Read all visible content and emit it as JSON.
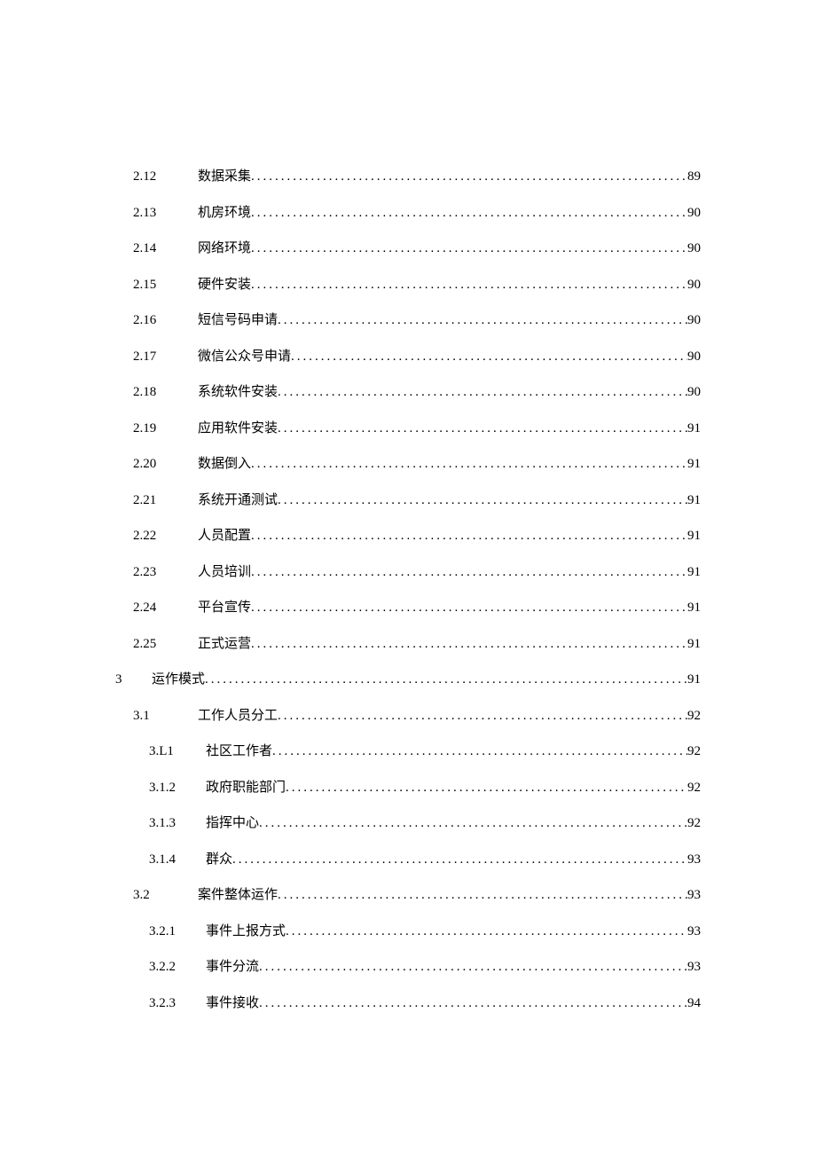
{
  "toc": [
    {
      "level": 1,
      "num": "2.12",
      "title": "数据采集",
      "page": "89"
    },
    {
      "level": 1,
      "num": "2.13",
      "title": "机房环境",
      "page": "90"
    },
    {
      "level": 1,
      "num": "2.14",
      "title": "网络环境",
      "page": "90"
    },
    {
      "level": 1,
      "num": "2.15",
      "title": "硬件安装",
      "page": "90"
    },
    {
      "level": 1,
      "num": "2.16",
      "title": "短信号码申请",
      "page": "90"
    },
    {
      "level": 1,
      "num": "2.17",
      "title": "微信公众号申请",
      "page": "90"
    },
    {
      "level": 1,
      "num": "2.18",
      "title": "系统软件安装",
      "page": "90"
    },
    {
      "level": 1,
      "num": "2.19",
      "title": "应用软件安装",
      "page": "91"
    },
    {
      "level": 1,
      "num": "2.20",
      "title": "数据倒入",
      "page": "91"
    },
    {
      "level": 1,
      "num": "2.21",
      "title": "系统开通测试",
      "page": "91"
    },
    {
      "level": 1,
      "num": "2.22",
      "title": "人员配置",
      "page": "91"
    },
    {
      "level": 1,
      "num": "2.23",
      "title": "人员培训",
      "page": "91"
    },
    {
      "level": 1,
      "num": "2.24",
      "title": "平台宣传",
      "page": "91"
    },
    {
      "level": 1,
      "num": "2.25",
      "title": "正式运营",
      "page": "91"
    },
    {
      "level": 0,
      "num": "3",
      "title": "运作模式",
      "page": "91"
    },
    {
      "level": 1,
      "num": "3.1",
      "title": "工作人员分工",
      "page": "92"
    },
    {
      "level": 2,
      "num": "3.L1",
      "title": "社区工作者",
      "page": "92"
    },
    {
      "level": 2,
      "num": "3.1.2",
      "title": "政府职能部门",
      "page": "92"
    },
    {
      "level": 2,
      "num": "3.1.3",
      "title": "指挥中心",
      "page": "92"
    },
    {
      "level": 2,
      "num": "3.1.4",
      "title": "群众",
      "page": "93"
    },
    {
      "level": 1,
      "num": "3.2",
      "title": "案件整体运作",
      "page": "93"
    },
    {
      "level": 2,
      "num": "3.2.1",
      "title": "事件上报方式",
      "page": "93"
    },
    {
      "level": 2,
      "num": "3.2.2",
      "title": "事件分流",
      "page": "93"
    },
    {
      "level": 2,
      "num": "3.2.3",
      "title": "事件接收",
      "page": "94"
    }
  ]
}
